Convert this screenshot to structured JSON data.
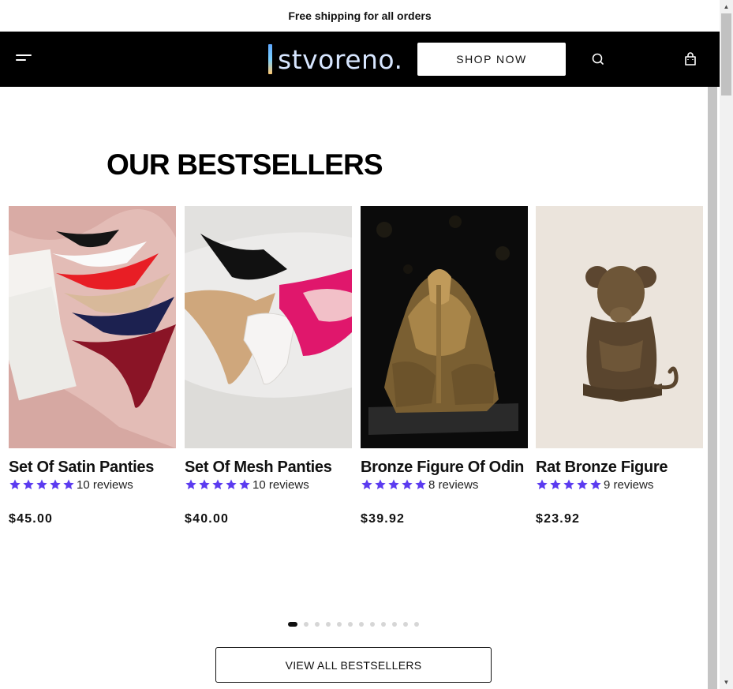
{
  "announcement": "Free shipping for all orders",
  "header": {
    "logo_text": "stvoreno.",
    "shop_now_label": "SHOP NOW",
    "icons": [
      "menu-icon",
      "search-icon",
      "shopping-bag-icon"
    ]
  },
  "section_title": "OUR BESTSELLERS",
  "products": [
    {
      "name": "Set Of Satin Panties",
      "rating": 5,
      "reviews": "10 reviews",
      "price": "$45.00",
      "image": "satin panties on pink fabric"
    },
    {
      "name": "Set Of Mesh Panties",
      "rating": 5,
      "reviews": "10 reviews",
      "price": "$40.00",
      "image": "mesh panties on white fabric"
    },
    {
      "name": "Bronze Figure Of Odin",
      "rating": 5,
      "reviews": "8 reviews",
      "price": "$39.92",
      "image": "bronze Odin figurine on black background"
    },
    {
      "name": "Rat Bronze Figure",
      "rating": 5,
      "reviews": "9 reviews",
      "price": "$23.92",
      "image": "bronze rat figurine on beige background"
    }
  ],
  "carousel": {
    "total_dots": 12,
    "active_index": 0
  },
  "view_all_label": "VIEW ALL BESTSELLERS",
  "colors": {
    "header_bg": "#000000",
    "star": "#5b3bf0",
    "text": "#111111"
  }
}
